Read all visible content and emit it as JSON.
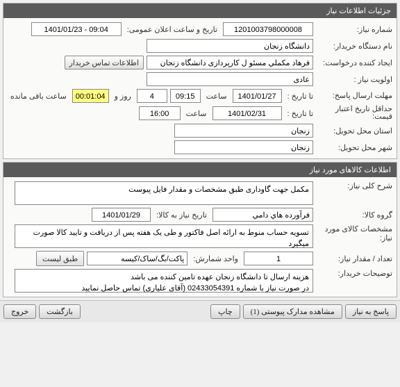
{
  "panel1": {
    "title": "جزئیات اطلاعات نیاز",
    "need_no_label": "شماره نیاز:",
    "need_no": "1201003798000008",
    "announce_label": "تاریخ و ساعت اعلان عمومی:",
    "announce_datetime": "1401/01/23 - 09:04",
    "buyer_label": "نام دستگاه خریدار:",
    "buyer": "دانشگاه زنجان",
    "requester_label": "ایجاد کننده درخواست:",
    "requester": "فرهاد مكملي مسئو ل کارپردازی دانشگاه زنجان",
    "contact_btn": "اطلاعات تماس خریدار",
    "priority_label": "اولویت نیاز :",
    "priority": "عادی",
    "resp_deadline_label": "مهلت ارسال پاسخ:",
    "resp_until_label": "تا تاریخ :",
    "resp_date": "1401/01/27",
    "time_label": "ساعت",
    "resp_time": "09:15",
    "days": "4",
    "days_label": "روز و",
    "countdown": "00:01:04",
    "remain_label": "ساعت باقی مانده",
    "price_valid_label": "حداقل تاریخ اعتبار قیمت:",
    "price_until_label": "تا تاریخ :",
    "price_date": "1401/02/31",
    "price_time": "16:00",
    "province_label": "استان محل تحویل:",
    "province": "زنجان",
    "city_label": "شهر محل تحویل:",
    "city": "زنجان"
  },
  "panel2": {
    "title": "اطلاعات کالاهای مورد نیاز",
    "desc_label": "شرح کلی نیاز:",
    "desc": "مکمل جهت گاوداری طبق مشخصات و مقدار فایل پیوست",
    "group_label": "گروه کالا:",
    "group": "فرآورده هاي دامي",
    "need_date_label": "تاریخ نیاز به کالا:",
    "need_date": "1401/01/29",
    "spec_label": "مشخصات کالای مورد نیاز:",
    "spec": "تسویه حساب منوط به ارائه اصل فاکتور و طی یک هفته پس از دریافت و تایید کالا صورت میگیرد",
    "qty_label": "تعداد / مقدار نیاز:",
    "qty": "1",
    "unit_label": "واحد شمارش:",
    "unit": "پاکت/بگ/ساک/کیسه",
    "list_btn": "طبق لیست",
    "notes_label": "توضیحات خریدار:",
    "notes": "هزینه ارسال تا دانشگاه زنجان عهده تامین کننده می باشد\nدر صورت نیاز با شماره 02433054391 (آقای علیاری) تماس حاصل نمایید"
  },
  "footer": {
    "respond": "پاسخ به نیاز",
    "attach": "مشاهده مدارک پیوستی (1)",
    "print": "چاپ",
    "back": "بازگشت",
    "exit": "خروج"
  }
}
